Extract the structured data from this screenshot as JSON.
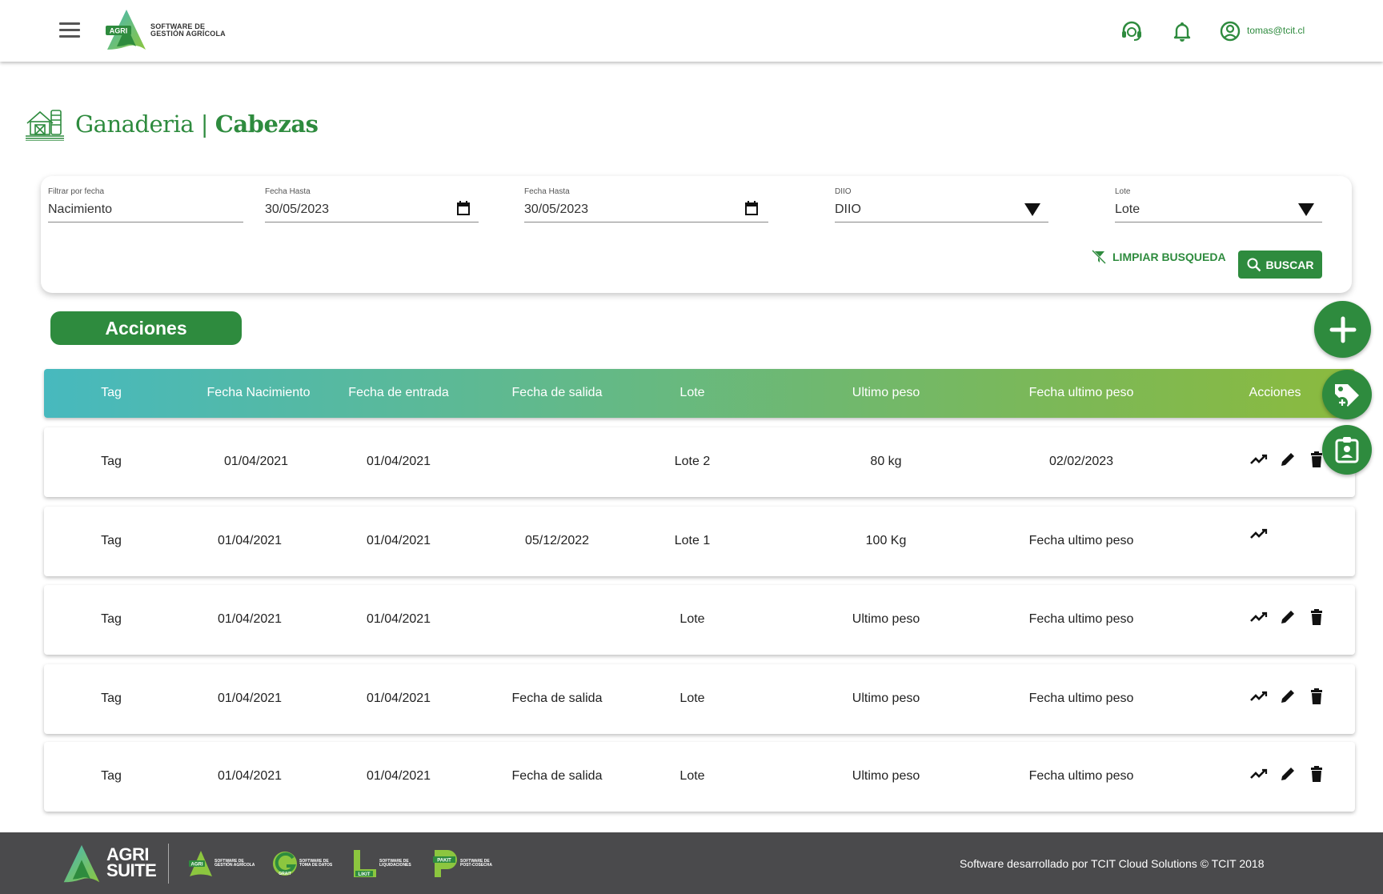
{
  "header": {
    "logo_badge": "AGRI",
    "logo_line1": "SOFTWARE DE",
    "logo_line2": "GESTIÓN AGRÍCOLA",
    "user_email": "tomas@tcit.cl"
  },
  "page": {
    "title_section": "Ganaderia",
    "title_separator": "|",
    "title_page": "Cabezas"
  },
  "filters": {
    "filtro_fecha": {
      "label": "Filtrar por fecha",
      "value": "Nacimiento"
    },
    "fecha_hasta_1": {
      "label": "Fecha Hasta",
      "value": "30/05/2023"
    },
    "fecha_hasta_2": {
      "label": "Fecha Hasta",
      "value": "30/05/2023"
    },
    "diio": {
      "label": "DIIO",
      "value": "DIIO"
    },
    "lote": {
      "label": "Lote",
      "value": "Lote"
    },
    "clear_label": "LIMPIAR BUSQUEDA",
    "search_label": "BUSCAR"
  },
  "actions_button": "Acciones",
  "table": {
    "headers": [
      "Tag",
      "Fecha Nacimiento",
      "Fecha de entrada",
      "Fecha de salida",
      "Lote",
      "Ultimo peso",
      "Fecha ultimo peso",
      "Acciones"
    ],
    "rows": [
      {
        "tag": "Tag",
        "nacimiento": "01/04/2021",
        "entrada": "01/04/2021",
        "salida": "",
        "lote": "Lote 2",
        "peso": "80 kg",
        "fecha_peso": "02/02/2023"
      },
      {
        "tag": "Tag",
        "nacimiento": "01/04/2021",
        "entrada": "01/04/2021",
        "salida": "05/12/2022",
        "lote": "Lote 1",
        "peso": "100 Kg",
        "fecha_peso": "Fecha ultimo peso"
      },
      {
        "tag": "Tag",
        "nacimiento": "01/04/2021",
        "entrada": "01/04/2021",
        "salida": "",
        "lote": "Lote",
        "peso": "Ultimo peso",
        "fecha_peso": "Fecha ultimo peso"
      },
      {
        "tag": "Tag",
        "nacimiento": "01/04/2021",
        "entrada": "01/04/2021",
        "salida": "Fecha de salida",
        "lote": "Lote",
        "peso": "Ultimo peso",
        "fecha_peso": "Fecha ultimo peso"
      },
      {
        "tag": "Tag",
        "nacimiento": "01/04/2021",
        "entrada": "01/04/2021",
        "salida": "Fecha de salida",
        "lote": "Lote",
        "peso": "Ultimo peso",
        "fecha_peso": "Fecha ultimo peso"
      }
    ]
  },
  "footer": {
    "brand_line1": "AGRI",
    "brand_line2": "SUITE",
    "products": [
      {
        "badge": "AGRI",
        "line1": "SOFTWARE DE",
        "line2": "GESTIÓN AGRÍCOLA"
      },
      {
        "badge": "GRAIT",
        "line1": "SOFTWARE DE",
        "line2": "TOMA DE DATOS"
      },
      {
        "badge": "LIKIT",
        "line1": "SOFTWARE DE",
        "line2": "LIQUIDACIONES"
      },
      {
        "badge": "PAKIT",
        "line1": "SOFTWARE DE",
        "line2": "POST-COSECHA"
      }
    ],
    "credit": "Software desarrollado por TCIT Cloud Solutions © TCIT 2018"
  },
  "colors": {
    "primary": "#2e8b3e",
    "header_gradient_start": "#47b9be",
    "header_gradient_end": "#8bba3e",
    "footer_bg": "#4a4a4c"
  }
}
